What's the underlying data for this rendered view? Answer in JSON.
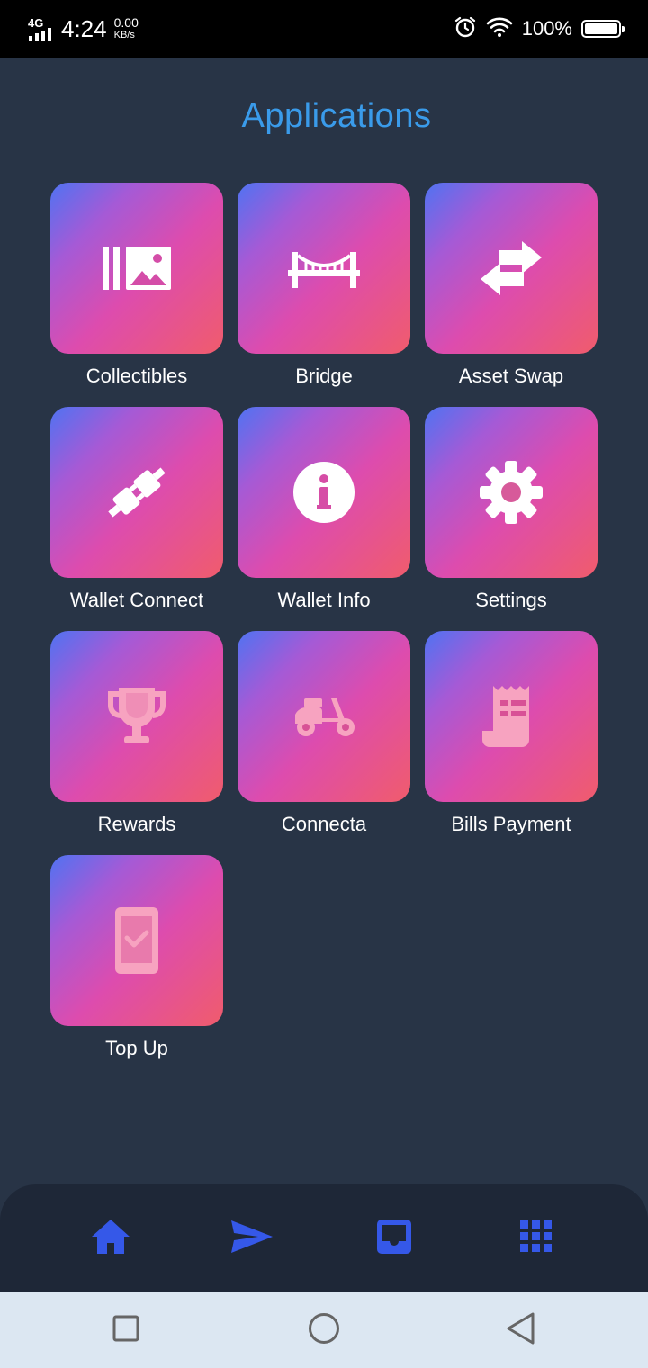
{
  "status_bar": {
    "network": "4G",
    "time": "4:24",
    "speed_value": "0.00",
    "speed_unit": "KB/s",
    "battery_percent": "100%",
    "icons": [
      "alarm-icon",
      "wifi-icon",
      "battery-icon"
    ]
  },
  "page": {
    "title": "Applications"
  },
  "apps": [
    {
      "label": "Collectibles",
      "icon": "collectibles-icon"
    },
    {
      "label": "Bridge",
      "icon": "bridge-icon"
    },
    {
      "label": "Asset Swap",
      "icon": "swap-arrows-icon"
    },
    {
      "label": "Wallet Connect",
      "icon": "plug-icon"
    },
    {
      "label": "Wallet Info",
      "icon": "info-icon"
    },
    {
      "label": "Settings",
      "icon": "gear-icon"
    },
    {
      "label": "Rewards",
      "icon": "trophy-icon"
    },
    {
      "label": "Connecta",
      "icon": "scooter-icon"
    },
    {
      "label": "Bills Payment",
      "icon": "receipt-icon"
    },
    {
      "label": "Top Up",
      "icon": "phone-check-icon"
    }
  ],
  "bottom_nav": {
    "items": [
      {
        "icon": "home-icon"
      },
      {
        "icon": "send-icon"
      },
      {
        "icon": "inbox-icon"
      },
      {
        "icon": "apps-grid-icon"
      }
    ],
    "accent_color": "#3558e8"
  },
  "system_nav": {
    "icons": [
      "recents-icon",
      "home-circle-icon",
      "back-icon"
    ]
  },
  "colors": {
    "background": "#283446",
    "title": "#3a9bea",
    "tile_gradient": [
      "#4f73f2",
      "#a55ad6",
      "#dd4cae",
      "#f05c6c"
    ]
  }
}
